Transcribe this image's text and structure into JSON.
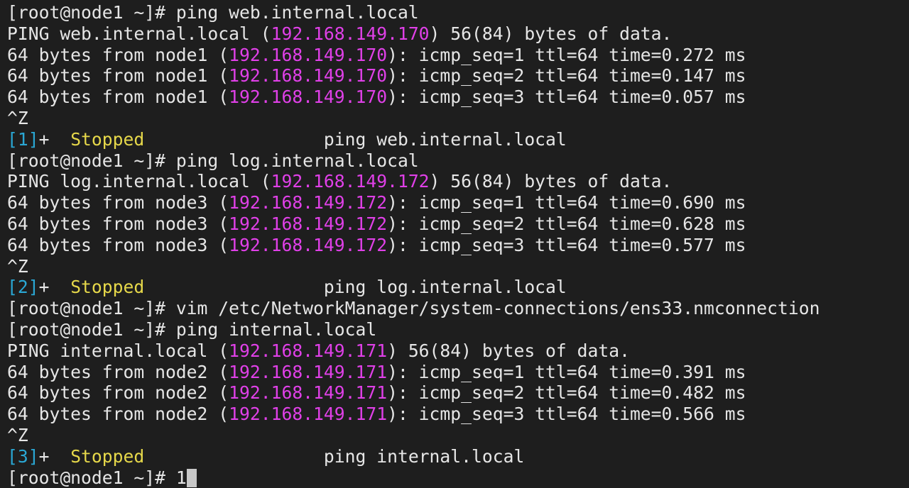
{
  "terminal": {
    "colors": {
      "background": "#1e1e1e",
      "foreground": "#e6e6e6",
      "ip_highlight": "#e040e8",
      "job_number": "#2aa7d4",
      "job_status": "#e6d84a",
      "cursor": "#c8c8c8"
    },
    "prompt": "[root@node1 ~]# ",
    "line_01": {
      "command": "ping web.internal.local"
    },
    "line_02": {
      "pre": "PING web.internal.local (",
      "ip": "192.168.149.170",
      "post": ") 56(84) bytes of data."
    },
    "line_03": {
      "pre": "64 bytes from node1 (",
      "ip": "192.168.149.170",
      "post": "): icmp_seq=1 ttl=64 time=0.272 ms"
    },
    "line_04": {
      "pre": "64 bytes from node1 (",
      "ip": "192.168.149.170",
      "post": "): icmp_seq=2 ttl=64 time=0.147 ms"
    },
    "line_05": {
      "pre": "64 bytes from node1 (",
      "ip": "192.168.149.170",
      "post": "): icmp_seq=3 ttl=64 time=0.057 ms"
    },
    "line_06": {
      "text": "^Z"
    },
    "line_07": {
      "job": "[1]",
      "flag": "+  ",
      "status": "Stopped",
      "gap": "                 ",
      "cmd": "ping web.internal.local"
    },
    "line_08": {
      "command": "ping log.internal.local"
    },
    "line_09": {
      "pre": "PING log.internal.local (",
      "ip": "192.168.149.172",
      "post": ") 56(84) bytes of data."
    },
    "line_10": {
      "pre": "64 bytes from node3 (",
      "ip": "192.168.149.172",
      "post": "): icmp_seq=1 ttl=64 time=0.690 ms"
    },
    "line_11": {
      "pre": "64 bytes from node3 (",
      "ip": "192.168.149.172",
      "post": "): icmp_seq=2 ttl=64 time=0.628 ms"
    },
    "line_12": {
      "pre": "64 bytes from node3 (",
      "ip": "192.168.149.172",
      "post": "): icmp_seq=3 ttl=64 time=0.577 ms"
    },
    "line_13": {
      "text": "^Z"
    },
    "line_14": {
      "job": "[2]",
      "flag": "+  ",
      "status": "Stopped",
      "gap": "                 ",
      "cmd": "ping log.internal.local"
    },
    "line_15": {
      "command": "vim /etc/NetworkManager/system-connections/ens33.nmconnection"
    },
    "line_16": {
      "command": "ping internal.local"
    },
    "line_17": {
      "pre": "PING internal.local (",
      "ip": "192.168.149.171",
      "post": ") 56(84) bytes of data."
    },
    "line_18": {
      "pre": "64 bytes from node2 (",
      "ip": "192.168.149.171",
      "post": "): icmp_seq=1 ttl=64 time=0.391 ms"
    },
    "line_19": {
      "pre": "64 bytes from node2 (",
      "ip": "192.168.149.171",
      "post": "): icmp_seq=2 ttl=64 time=0.482 ms"
    },
    "line_20": {
      "pre": "64 bytes from node2 (",
      "ip": "192.168.149.171",
      "post": "): icmp_seq=3 ttl=64 time=0.566 ms"
    },
    "line_21": {
      "text": "^Z"
    },
    "line_22": {
      "job": "[3]",
      "flag": "+  ",
      "status": "Stopped",
      "gap": "                 ",
      "cmd": "ping internal.local"
    },
    "line_23": {
      "input": "1"
    }
  }
}
